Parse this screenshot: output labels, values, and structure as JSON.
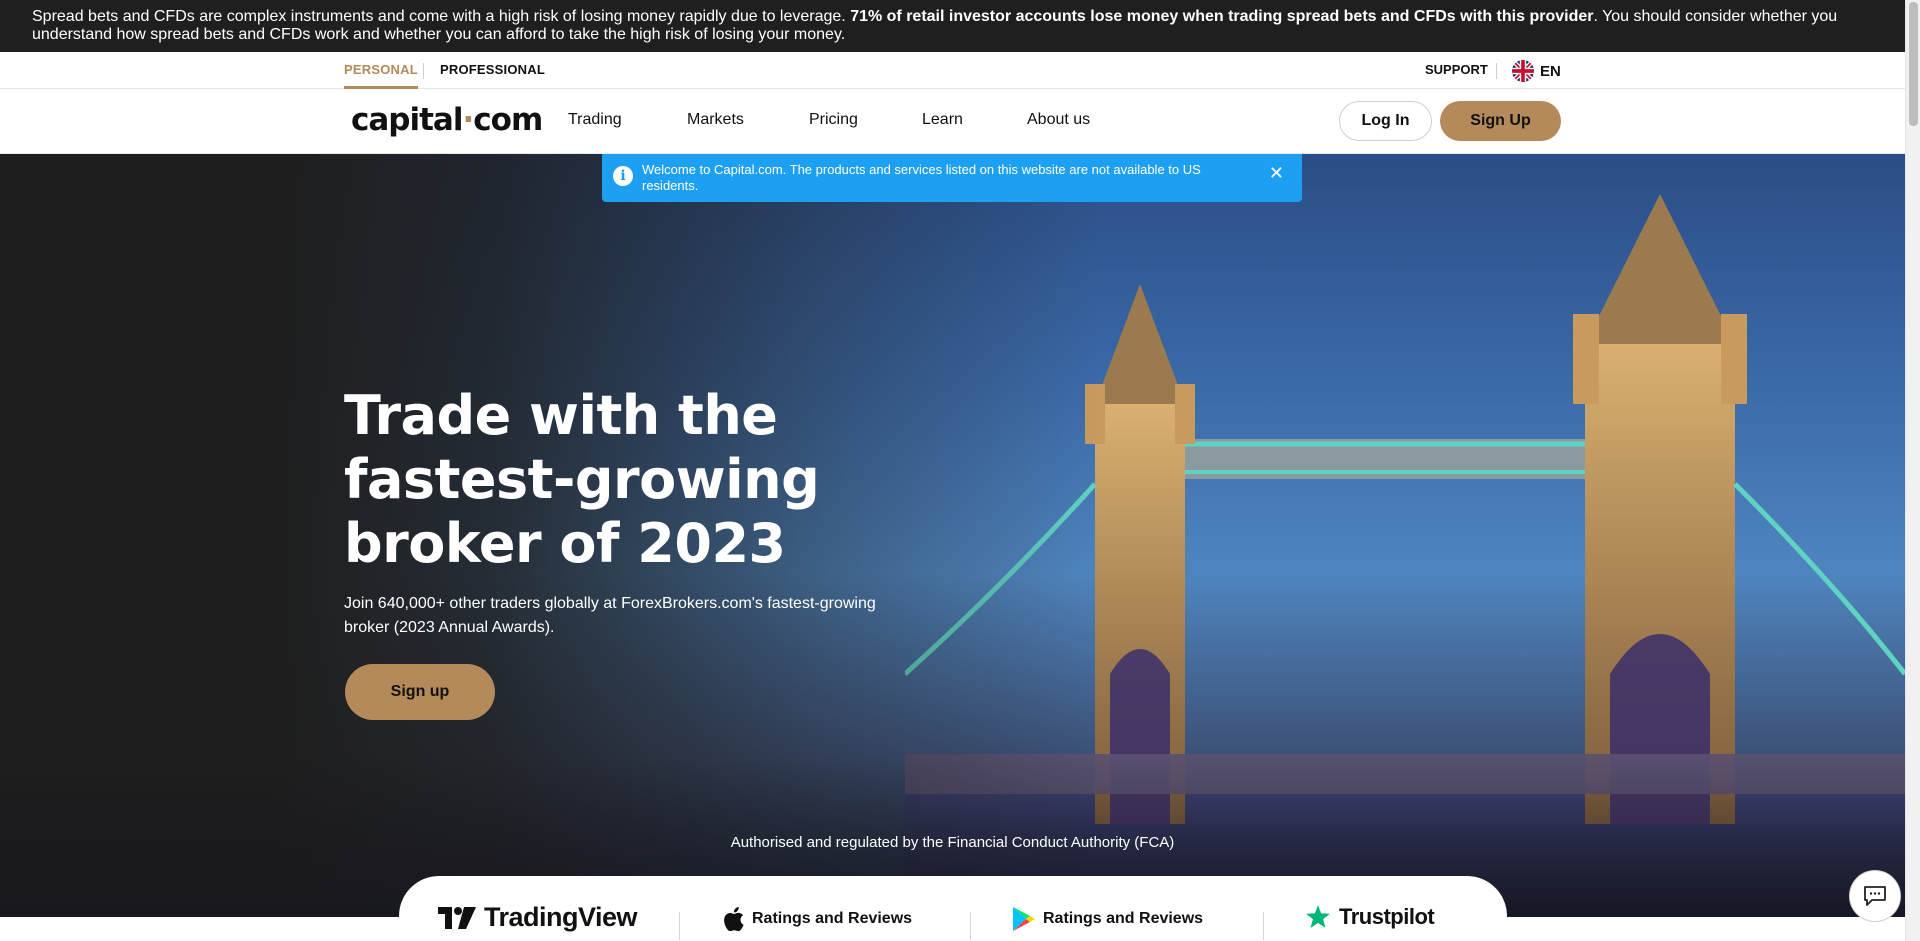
{
  "risk_warning": {
    "text_a": "Spread bets and CFDs are complex instruments and come with a high risk of losing money rapidly due to leverage. ",
    "bold": "71% of retail investor accounts lose money when trading spread bets and CFDs with this provider",
    "text_b": ". You should consider whether you understand how spread bets and CFDs work and whether you can afford to take the high risk of losing your money."
  },
  "topbar": {
    "personal": "PERSONAL",
    "professional": "PROFESSIONAL",
    "support": "SUPPORT",
    "language": "EN"
  },
  "nav": {
    "logo_a": "capital",
    "logo_dot": "·",
    "logo_b": "com",
    "items": [
      "Trading",
      "Markets",
      "Pricing",
      "Learn",
      "About us"
    ],
    "login": "Log In",
    "signup": "Sign Up"
  },
  "alert": {
    "icon": "i",
    "text": "Welcome to Capital.com. The products and services listed on this website are not available to US residents.",
    "close": "✕"
  },
  "hero": {
    "title": "Trade with the fastest-growing broker of 2023",
    "subtitle": "Join 640,000+ other traders globally at ForexBrokers.com's fastest-growing broker (2023 Annual Awards).",
    "cta": "Sign up",
    "regulation": "Authorised and regulated by the Financial Conduct Authority (FCA)"
  },
  "ratings": {
    "tradingview": "TradingView",
    "apple": "Ratings and Reviews",
    "google": "Ratings and Reviews",
    "trustpilot": "Trustpilot"
  },
  "colors": {
    "accent": "#b58a5a",
    "alert_blue": "#1ea0f2",
    "dark": "#1f1f1f"
  },
  "icons": [
    "info-icon",
    "close-icon",
    "uk-flag-icon",
    "tradingview-logo-icon",
    "apple-icon",
    "google-play-icon",
    "trustpilot-star-icon",
    "chat-icon"
  ]
}
